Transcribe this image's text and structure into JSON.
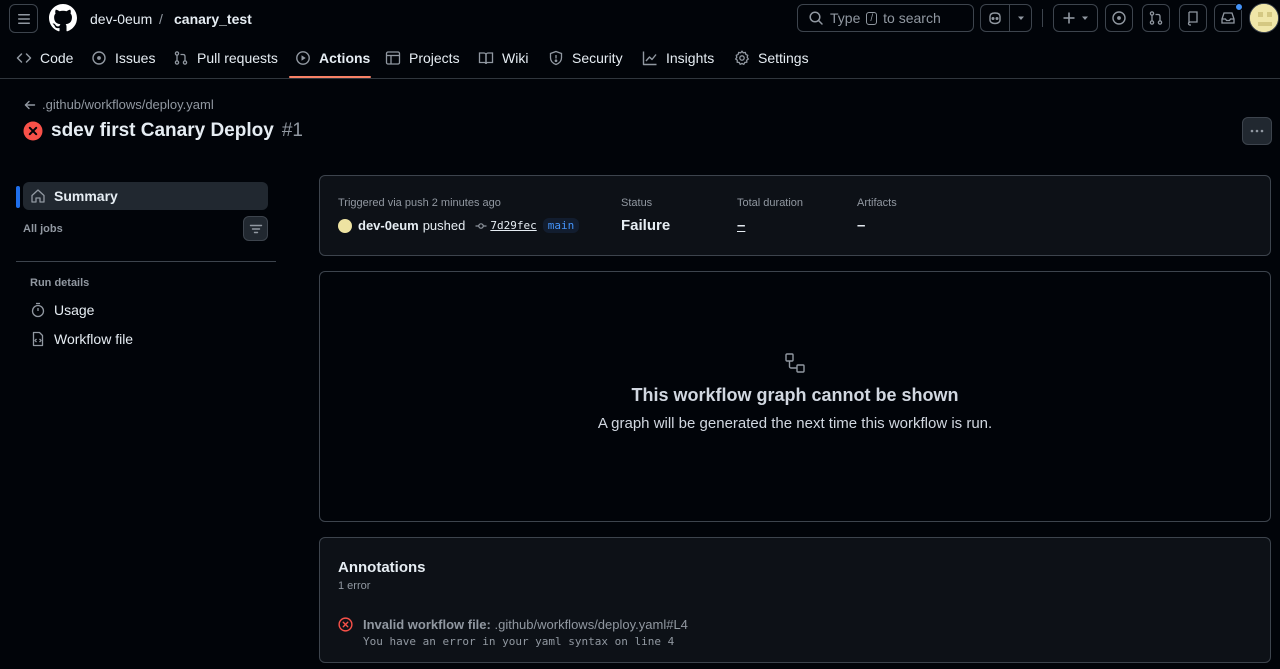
{
  "header": {
    "owner": "dev-0eum",
    "separator": "/",
    "repo": "canary_test",
    "search": {
      "prefix": "Type",
      "key": "/",
      "suffix": "to search"
    }
  },
  "tabs": [
    {
      "label": "Code",
      "icon": "code-icon"
    },
    {
      "label": "Issues",
      "icon": "issue-opened-icon"
    },
    {
      "label": "Pull requests",
      "icon": "git-pull-request-icon"
    },
    {
      "label": "Actions",
      "icon": "play-icon",
      "active": true
    },
    {
      "label": "Projects",
      "icon": "table-icon"
    },
    {
      "label": "Wiki",
      "icon": "book-icon"
    },
    {
      "label": "Security",
      "icon": "shield-icon"
    },
    {
      "label": "Insights",
      "icon": "graph-icon"
    },
    {
      "label": "Settings",
      "icon": "gear-icon"
    }
  ],
  "run": {
    "back_link": ".github/workflows/deploy.yaml",
    "title": "sdev first Canary Deploy",
    "number": "#1"
  },
  "sidebar": {
    "summary": "Summary",
    "all_jobs": "All jobs",
    "run_details": "Run details",
    "usage": "Usage",
    "workflow_file": "Workflow file"
  },
  "summary": {
    "trigger_label": "Triggered via push 2 minutes ago",
    "actor": "dev-0eum",
    "action": "pushed",
    "commit": "7d29fec",
    "branch": "main",
    "status_label": "Status",
    "status_value": "Failure",
    "duration_label": "Total duration",
    "duration_value": "–",
    "artifacts_label": "Artifacts",
    "artifacts_value": "–"
  },
  "graph": {
    "title": "This workflow graph cannot be shown",
    "subtitle": "A graph will be generated the next time this workflow is run."
  },
  "annotations": {
    "title": "Annotations",
    "count": "1 error",
    "item_title": "Invalid workflow file:",
    "item_path": ".github/workflows/deploy.yaml#L4",
    "item_message": "You have an error in your yaml syntax on line 4"
  },
  "colors": {
    "accent": "#f78166",
    "link": "#4493f8",
    "error": "#f85149",
    "background": "#010409"
  }
}
